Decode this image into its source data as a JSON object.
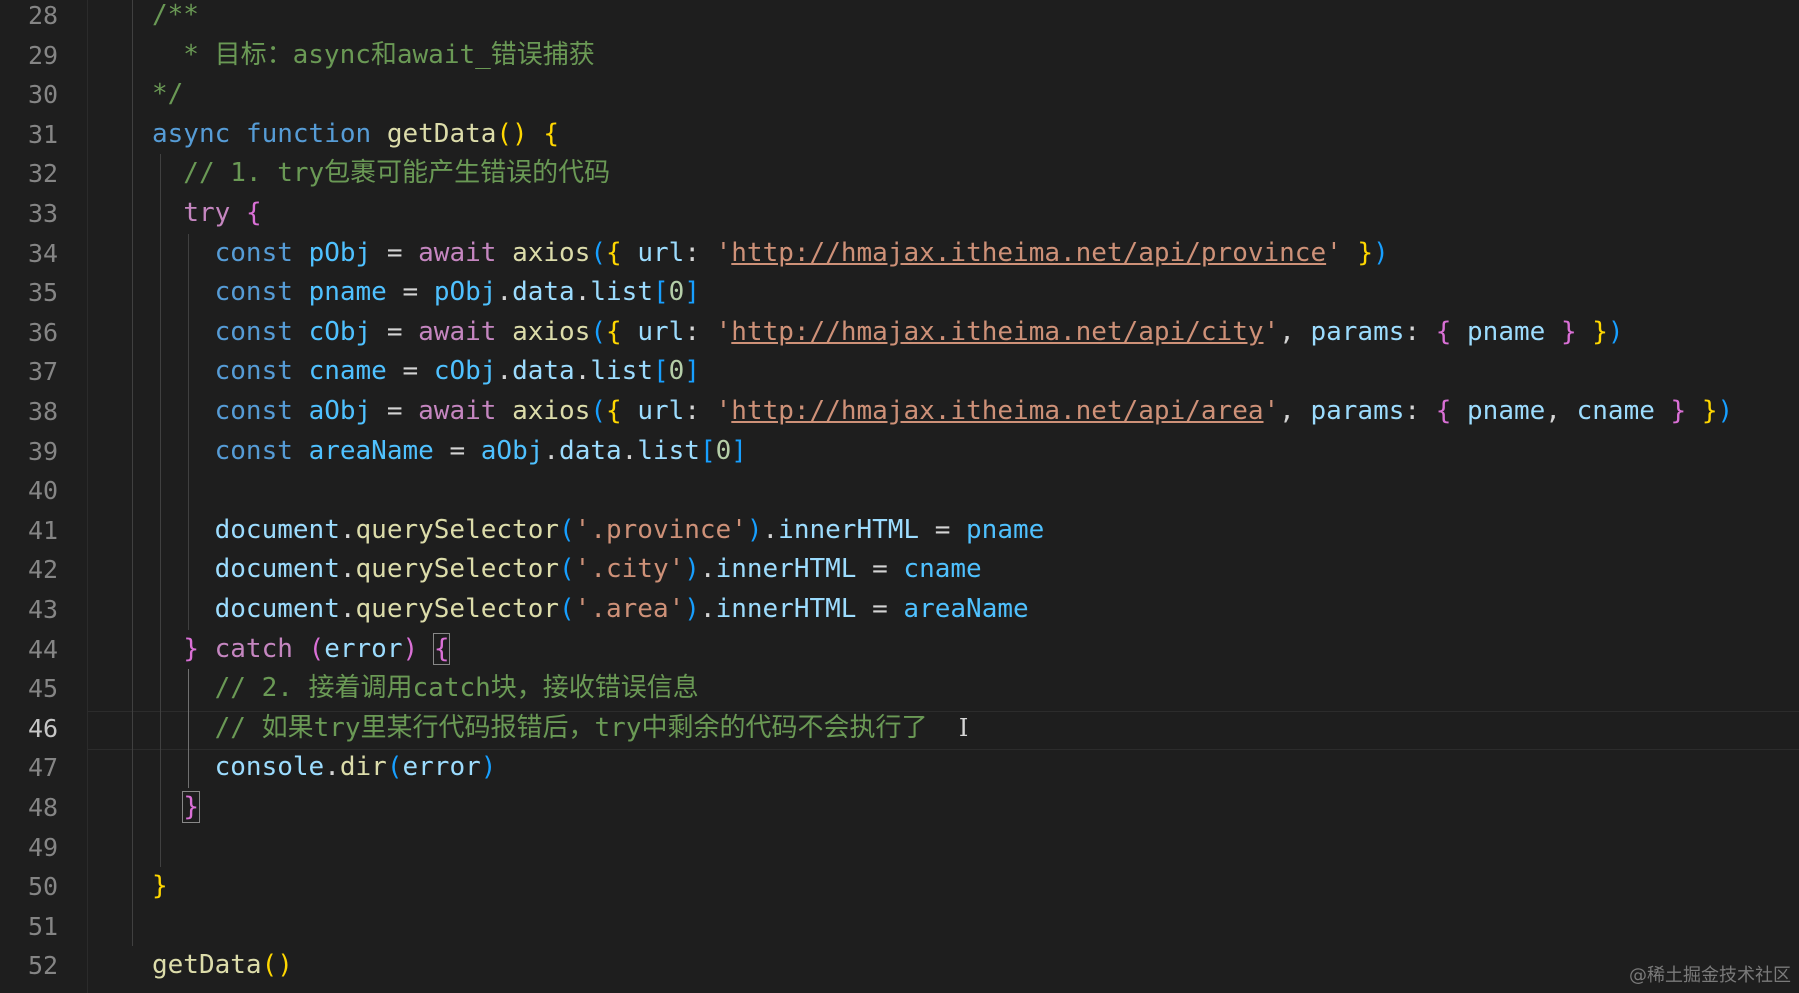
{
  "editor": {
    "current_line": "46",
    "watermark": "@稀土掘金技术社区",
    "line_numbers": [
      "28",
      "29",
      "30",
      "31",
      "32",
      "33",
      "34",
      "35",
      "36",
      "37",
      "38",
      "39",
      "40",
      "41",
      "42",
      "43",
      "44",
      "45",
      "46",
      "47",
      "48",
      "49",
      "50",
      "51",
      "52"
    ],
    "lines": [
      [
        {
          "t": "/**",
          "c": "comment"
        }
      ],
      [
        {
          "t": "  * 目标：async和await_错误捕获",
          "c": "comment"
        }
      ],
      [
        {
          "t": "*/",
          "c": "comment"
        }
      ],
      [
        {
          "t": "async",
          "c": "keyword"
        },
        {
          "t": " ",
          "c": "plain"
        },
        {
          "t": "function",
          "c": "keyword"
        },
        {
          "t": " ",
          "c": "plain"
        },
        {
          "t": "getData",
          "c": "func"
        },
        {
          "t": "()",
          "c": "b1"
        },
        {
          "t": " ",
          "c": "plain"
        },
        {
          "t": "{",
          "c": "b1"
        }
      ],
      [
        {
          "t": "  // 1. try包裹可能产生错误的代码",
          "c": "comment"
        }
      ],
      [
        {
          "t": "  ",
          "c": "plain"
        },
        {
          "t": "try",
          "c": "control"
        },
        {
          "t": " ",
          "c": "plain"
        },
        {
          "t": "{",
          "c": "b2"
        }
      ],
      [
        {
          "t": "    ",
          "c": "plain"
        },
        {
          "t": "const",
          "c": "keyword"
        },
        {
          "t": " ",
          "c": "plain"
        },
        {
          "t": "pObj",
          "c": "const"
        },
        {
          "t": " = ",
          "c": "plain"
        },
        {
          "t": "await",
          "c": "control"
        },
        {
          "t": " ",
          "c": "plain"
        },
        {
          "t": "axios",
          "c": "func"
        },
        {
          "t": "(",
          "c": "b3"
        },
        {
          "t": "{",
          "c": "b1"
        },
        {
          "t": " ",
          "c": "plain"
        },
        {
          "t": "url",
          "c": "var"
        },
        {
          "t": ": ",
          "c": "plain"
        },
        {
          "t": "'",
          "c": "string"
        },
        {
          "t": "http://hmajax.itheima.net/api/province",
          "c": "url"
        },
        {
          "t": "'",
          "c": "string"
        },
        {
          "t": " ",
          "c": "plain"
        },
        {
          "t": "}",
          "c": "b1"
        },
        {
          "t": ")",
          "c": "b3"
        }
      ],
      [
        {
          "t": "    ",
          "c": "plain"
        },
        {
          "t": "const",
          "c": "keyword"
        },
        {
          "t": " ",
          "c": "plain"
        },
        {
          "t": "pname",
          "c": "const"
        },
        {
          "t": " = ",
          "c": "plain"
        },
        {
          "t": "pObj",
          "c": "const"
        },
        {
          "t": ".",
          "c": "plain"
        },
        {
          "t": "data",
          "c": "var"
        },
        {
          "t": ".",
          "c": "plain"
        },
        {
          "t": "list",
          "c": "var"
        },
        {
          "t": "[",
          "c": "b3"
        },
        {
          "t": "0",
          "c": "num"
        },
        {
          "t": "]",
          "c": "b3"
        }
      ],
      [
        {
          "t": "    ",
          "c": "plain"
        },
        {
          "t": "const",
          "c": "keyword"
        },
        {
          "t": " ",
          "c": "plain"
        },
        {
          "t": "cObj",
          "c": "const"
        },
        {
          "t": " = ",
          "c": "plain"
        },
        {
          "t": "await",
          "c": "control"
        },
        {
          "t": " ",
          "c": "plain"
        },
        {
          "t": "axios",
          "c": "func"
        },
        {
          "t": "(",
          "c": "b3"
        },
        {
          "t": "{",
          "c": "b1"
        },
        {
          "t": " ",
          "c": "plain"
        },
        {
          "t": "url",
          "c": "var"
        },
        {
          "t": ": ",
          "c": "plain"
        },
        {
          "t": "'",
          "c": "string"
        },
        {
          "t": "http://hmajax.itheima.net/api/city",
          "c": "url"
        },
        {
          "t": "'",
          "c": "string"
        },
        {
          "t": ", ",
          "c": "plain"
        },
        {
          "t": "params",
          "c": "var"
        },
        {
          "t": ": ",
          "c": "plain"
        },
        {
          "t": "{",
          "c": "b2"
        },
        {
          "t": " ",
          "c": "plain"
        },
        {
          "t": "pname",
          "c": "var"
        },
        {
          "t": " ",
          "c": "plain"
        },
        {
          "t": "}",
          "c": "b2"
        },
        {
          "t": " ",
          "c": "plain"
        },
        {
          "t": "}",
          "c": "b1"
        },
        {
          "t": ")",
          "c": "b3"
        }
      ],
      [
        {
          "t": "    ",
          "c": "plain"
        },
        {
          "t": "const",
          "c": "keyword"
        },
        {
          "t": " ",
          "c": "plain"
        },
        {
          "t": "cname",
          "c": "const"
        },
        {
          "t": " = ",
          "c": "plain"
        },
        {
          "t": "cObj",
          "c": "const"
        },
        {
          "t": ".",
          "c": "plain"
        },
        {
          "t": "data",
          "c": "var"
        },
        {
          "t": ".",
          "c": "plain"
        },
        {
          "t": "list",
          "c": "var"
        },
        {
          "t": "[",
          "c": "b3"
        },
        {
          "t": "0",
          "c": "num"
        },
        {
          "t": "]",
          "c": "b3"
        }
      ],
      [
        {
          "t": "    ",
          "c": "plain"
        },
        {
          "t": "const",
          "c": "keyword"
        },
        {
          "t": " ",
          "c": "plain"
        },
        {
          "t": "aObj",
          "c": "const"
        },
        {
          "t": " = ",
          "c": "plain"
        },
        {
          "t": "await",
          "c": "control"
        },
        {
          "t": " ",
          "c": "plain"
        },
        {
          "t": "axios",
          "c": "func"
        },
        {
          "t": "(",
          "c": "b3"
        },
        {
          "t": "{",
          "c": "b1"
        },
        {
          "t": " ",
          "c": "plain"
        },
        {
          "t": "url",
          "c": "var"
        },
        {
          "t": ": ",
          "c": "plain"
        },
        {
          "t": "'",
          "c": "string"
        },
        {
          "t": "http://hmajax.itheima.net/api/area",
          "c": "url"
        },
        {
          "t": "'",
          "c": "string"
        },
        {
          "t": ", ",
          "c": "plain"
        },
        {
          "t": "params",
          "c": "var"
        },
        {
          "t": ": ",
          "c": "plain"
        },
        {
          "t": "{",
          "c": "b2"
        },
        {
          "t": " ",
          "c": "plain"
        },
        {
          "t": "pname",
          "c": "var"
        },
        {
          "t": ", ",
          "c": "plain"
        },
        {
          "t": "cname",
          "c": "var"
        },
        {
          "t": " ",
          "c": "plain"
        },
        {
          "t": "}",
          "c": "b2"
        },
        {
          "t": " ",
          "c": "plain"
        },
        {
          "t": "}",
          "c": "b1"
        },
        {
          "t": ")",
          "c": "b3"
        }
      ],
      [
        {
          "t": "    ",
          "c": "plain"
        },
        {
          "t": "const",
          "c": "keyword"
        },
        {
          "t": " ",
          "c": "plain"
        },
        {
          "t": "areaName",
          "c": "const"
        },
        {
          "t": " = ",
          "c": "plain"
        },
        {
          "t": "aObj",
          "c": "const"
        },
        {
          "t": ".",
          "c": "plain"
        },
        {
          "t": "data",
          "c": "var"
        },
        {
          "t": ".",
          "c": "plain"
        },
        {
          "t": "list",
          "c": "var"
        },
        {
          "t": "[",
          "c": "b3"
        },
        {
          "t": "0",
          "c": "num"
        },
        {
          "t": "]",
          "c": "b3"
        }
      ],
      [],
      [
        {
          "t": "    ",
          "c": "plain"
        },
        {
          "t": "document",
          "c": "var"
        },
        {
          "t": ".",
          "c": "plain"
        },
        {
          "t": "querySelector",
          "c": "func"
        },
        {
          "t": "(",
          "c": "b3"
        },
        {
          "t": "'.province'",
          "c": "string"
        },
        {
          "t": ")",
          "c": "b3"
        },
        {
          "t": ".",
          "c": "plain"
        },
        {
          "t": "innerHTML",
          "c": "var"
        },
        {
          "t": " = ",
          "c": "plain"
        },
        {
          "t": "pname",
          "c": "const"
        }
      ],
      [
        {
          "t": "    ",
          "c": "plain"
        },
        {
          "t": "document",
          "c": "var"
        },
        {
          "t": ".",
          "c": "plain"
        },
        {
          "t": "querySelector",
          "c": "func"
        },
        {
          "t": "(",
          "c": "b3"
        },
        {
          "t": "'.city'",
          "c": "string"
        },
        {
          "t": ")",
          "c": "b3"
        },
        {
          "t": ".",
          "c": "plain"
        },
        {
          "t": "innerHTML",
          "c": "var"
        },
        {
          "t": " = ",
          "c": "plain"
        },
        {
          "t": "cname",
          "c": "const"
        }
      ],
      [
        {
          "t": "    ",
          "c": "plain"
        },
        {
          "t": "document",
          "c": "var"
        },
        {
          "t": ".",
          "c": "plain"
        },
        {
          "t": "querySelector",
          "c": "func"
        },
        {
          "t": "(",
          "c": "b3"
        },
        {
          "t": "'.area'",
          "c": "string"
        },
        {
          "t": ")",
          "c": "b3"
        },
        {
          "t": ".",
          "c": "plain"
        },
        {
          "t": "innerHTML",
          "c": "var"
        },
        {
          "t": " = ",
          "c": "plain"
        },
        {
          "t": "areaName",
          "c": "const"
        }
      ],
      [
        {
          "t": "  ",
          "c": "plain"
        },
        {
          "t": "}",
          "c": "b2"
        },
        {
          "t": " ",
          "c": "plain"
        },
        {
          "t": "catch",
          "c": "control"
        },
        {
          "t": " ",
          "c": "plain"
        },
        {
          "t": "(",
          "c": "b2"
        },
        {
          "t": "error",
          "c": "var"
        },
        {
          "t": ")",
          "c": "b2"
        },
        {
          "t": " ",
          "c": "plain"
        },
        {
          "t": "{",
          "c": "b2",
          "m": true
        }
      ],
      [
        {
          "t": "    // 2. 接着调用catch块，接收错误信息",
          "c": "comment"
        }
      ],
      [
        {
          "t": "    // 如果try里某行代码报错后，try中剩余的代码不会执行了",
          "c": "comment"
        },
        {
          "t": "  ",
          "c": "plain"
        },
        {
          "t": "I",
          "c": "cursor"
        }
      ],
      [
        {
          "t": "    ",
          "c": "plain"
        },
        {
          "t": "console",
          "c": "var"
        },
        {
          "t": ".",
          "c": "plain"
        },
        {
          "t": "dir",
          "c": "func"
        },
        {
          "t": "(",
          "c": "b3"
        },
        {
          "t": "error",
          "c": "var"
        },
        {
          "t": ")",
          "c": "b3"
        }
      ],
      [
        {
          "t": "  ",
          "c": "plain"
        },
        {
          "t": "}",
          "c": "b2",
          "m": true
        }
      ],
      [],
      [
        {
          "t": "}",
          "c": "b1"
        }
      ],
      [],
      [
        {
          "t": "getData",
          "c": "func"
        },
        {
          "t": "()",
          "c": "b1"
        }
      ]
    ]
  }
}
